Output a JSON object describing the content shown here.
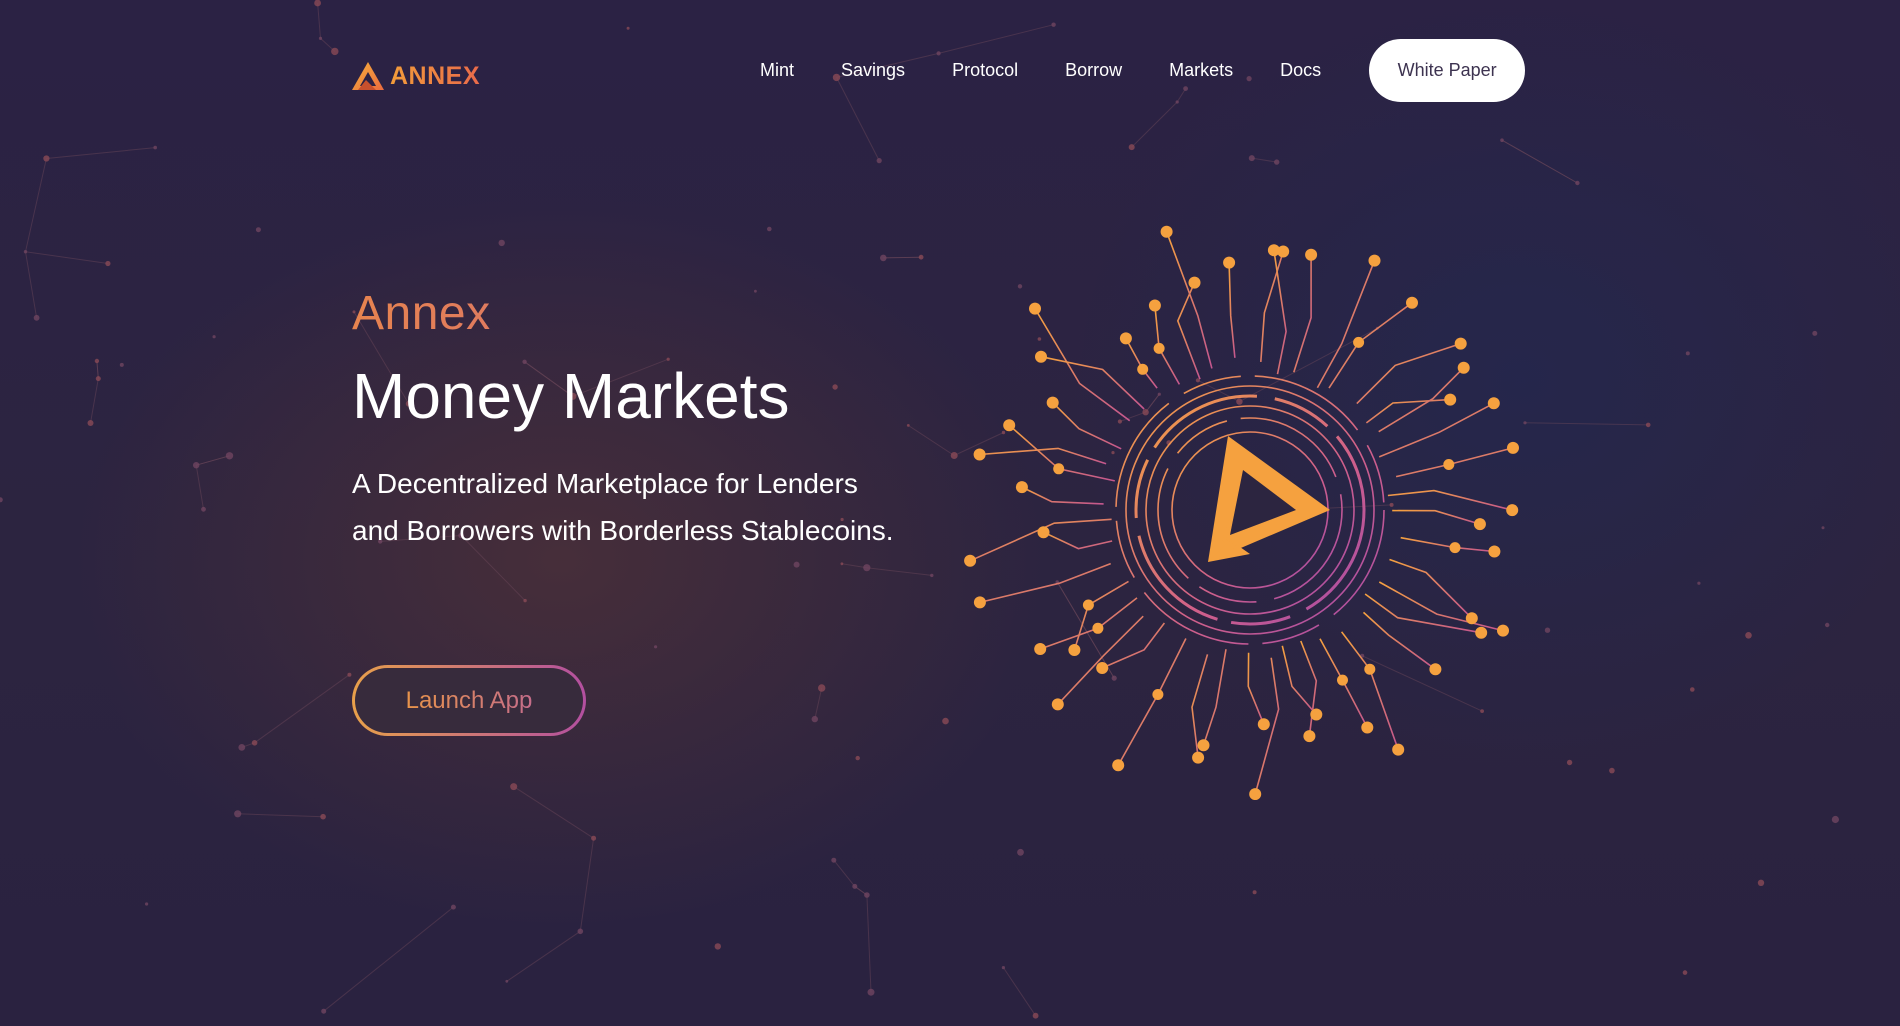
{
  "brand": {
    "logo_text": "ANNEX",
    "accent_color": "#f5a13f",
    "accent_secondary": "#b14fa2"
  },
  "nav": {
    "items": [
      {
        "label": "Mint"
      },
      {
        "label": "Savings"
      },
      {
        "label": "Protocol"
      },
      {
        "label": "Borrow"
      },
      {
        "label": "Markets"
      },
      {
        "label": "Docs"
      }
    ],
    "cta_label": "White Paper"
  },
  "hero": {
    "eyebrow": "Annex",
    "title": "Money Markets",
    "subtitle": "A Decentralized Marketplace for Lenders and Borrowers with Borderless Stablecoins.",
    "launch_label": "Launch App"
  },
  "icons": {
    "logo": "annex-triangle-logo-icon",
    "emblem": "circuit-play-emblem-icon",
    "background": "constellation-network-pattern"
  },
  "colors": {
    "background_top": "#2b2244",
    "background_bottom": "#2a2240",
    "button_bg": "#ffffff",
    "button_text": "#3d3350"
  }
}
